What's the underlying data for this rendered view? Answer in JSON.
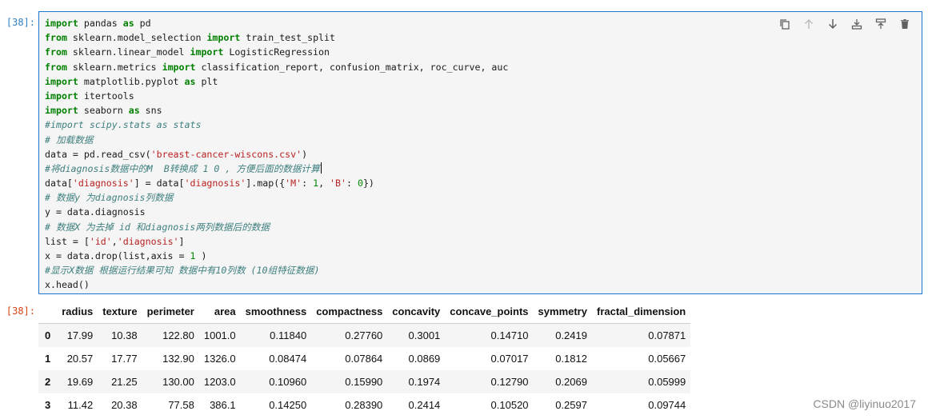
{
  "prompts": {
    "input": "[38]:",
    "output": "[38]:"
  },
  "toolbar": {
    "buttons": [
      {
        "name": "duplicate-icon",
        "glyph": "copy"
      },
      {
        "name": "move-up-icon",
        "glyph": "arrow-up"
      },
      {
        "name": "move-down-icon",
        "glyph": "arrow-down"
      },
      {
        "name": "insert-above-icon",
        "glyph": "insert-above"
      },
      {
        "name": "insert-below-icon",
        "glyph": "insert-below"
      },
      {
        "name": "delete-icon",
        "glyph": "trash"
      }
    ]
  },
  "code_lines": [
    [
      [
        "kw",
        "import"
      ],
      [
        "t",
        " pandas "
      ],
      [
        "kw",
        "as"
      ],
      [
        "t",
        " pd"
      ]
    ],
    [
      [
        "kw",
        "from"
      ],
      [
        "t",
        " sklearn.model_selection "
      ],
      [
        "kw",
        "import"
      ],
      [
        "t",
        " train_test_split"
      ]
    ],
    [
      [
        "kw",
        "from"
      ],
      [
        "t",
        " sklearn.linear_model "
      ],
      [
        "kw",
        "import"
      ],
      [
        "t",
        " LogisticRegression"
      ]
    ],
    [
      [
        "kw",
        "from"
      ],
      [
        "t",
        " sklearn.metrics "
      ],
      [
        "kw",
        "import"
      ],
      [
        "t",
        " classification_report, confusion_matrix, roc_curve, auc"
      ]
    ],
    [
      [
        "kw",
        "import"
      ],
      [
        "t",
        " matplotlib.pyplot "
      ],
      [
        "kw",
        "as"
      ],
      [
        "t",
        " plt"
      ]
    ],
    [
      [
        "kw",
        "import"
      ],
      [
        "t",
        " itertools"
      ]
    ],
    [
      [
        "kw",
        "import"
      ],
      [
        "t",
        " seaborn "
      ],
      [
        "kw",
        "as"
      ],
      [
        "t",
        " sns"
      ]
    ],
    [
      [
        "cm",
        "#import scipy.stats as stats"
      ]
    ],
    [
      [
        "cm",
        "# 加载数据"
      ]
    ],
    [
      [
        "t",
        "data = pd.read_csv("
      ],
      [
        "str",
        "'breast-cancer-wiscons.csv'"
      ],
      [
        "t",
        ")"
      ]
    ],
    [
      [
        "cm",
        "#将diagnosis数据中的M  B转换成 1 0 , 方便后面的数据计算"
      ]
    ],
    [
      [
        "t",
        "data["
      ],
      [
        "str",
        "'diagnosis'"
      ],
      [
        "t",
        "] = data["
      ],
      [
        "str",
        "'diagnosis'"
      ],
      [
        "t",
        "].map({"
      ],
      [
        "str",
        "'M'"
      ],
      [
        "t",
        ": "
      ],
      [
        "num",
        "1"
      ],
      [
        "t",
        ", "
      ],
      [
        "str",
        "'B'"
      ],
      [
        "t",
        ": "
      ],
      [
        "num",
        "0"
      ],
      [
        "t",
        "})"
      ]
    ],
    [
      [
        "cm",
        "# 数据y 为diagnosis列数据"
      ]
    ],
    [
      [
        "t",
        "y = data.diagnosis"
      ]
    ],
    [
      [
        "cm",
        "# 数据X 为去掉 id 和diagnosis两列数据后的数据"
      ]
    ],
    [
      [
        "t",
        "list = ["
      ],
      [
        "str",
        "'id'"
      ],
      [
        "t",
        ","
      ],
      [
        "str",
        "'diagnosis'"
      ],
      [
        "t",
        "]"
      ]
    ],
    [
      [
        "t",
        "x = data.drop(list,axis = "
      ],
      [
        "num",
        "1"
      ],
      [
        "t",
        " )"
      ]
    ],
    [
      [
        "cm",
        "#显示X数据 根据运行结果可知 数据中有10列数 (10组特征数据)"
      ]
    ],
    [
      [
        "t",
        "x.head()"
      ]
    ]
  ],
  "table": {
    "index_header": "",
    "columns": [
      "radius",
      "texture",
      "perimeter",
      "area",
      "smoothness",
      "compactness",
      "concavity",
      "concave_points",
      "symmetry",
      "fractal_dimension"
    ],
    "rows": [
      {
        "index": "0",
        "values": [
          "17.99",
          "10.38",
          "122.80",
          "1001.0",
          "0.11840",
          "0.27760",
          "0.3001",
          "0.14710",
          "0.2419",
          "0.07871"
        ]
      },
      {
        "index": "1",
        "values": [
          "20.57",
          "17.77",
          "132.90",
          "1326.0",
          "0.08474",
          "0.07864",
          "0.0869",
          "0.07017",
          "0.1812",
          "0.05667"
        ]
      },
      {
        "index": "2",
        "values": [
          "19.69",
          "21.25",
          "130.00",
          "1203.0",
          "0.10960",
          "0.15990",
          "0.1974",
          "0.12790",
          "0.2069",
          "0.05999"
        ]
      },
      {
        "index": "3",
        "values": [
          "11.42",
          "20.38",
          "77.58",
          "386.1",
          "0.14250",
          "0.28390",
          "0.2414",
          "0.10520",
          "0.2597",
          "0.09744"
        ]
      }
    ]
  },
  "watermark": "CSDN @liyinuo2017",
  "colors": {
    "keyword": "#008000",
    "string": "#ba2121",
    "number": "#008800",
    "comment": "#408080",
    "cell_border": "#1976d2",
    "in_prompt": "#307fc1",
    "out_prompt": "#d84315"
  }
}
